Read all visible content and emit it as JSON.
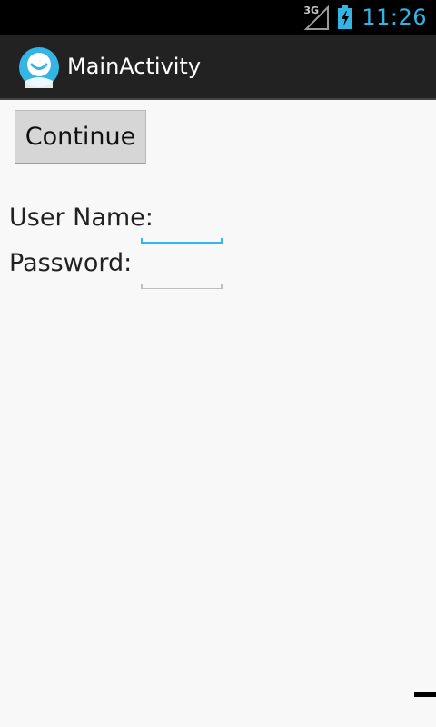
{
  "status_bar": {
    "network_type": "3G",
    "time": "11:26",
    "icons": [
      "signal-icon",
      "battery-charging-icon"
    ],
    "clock_color": "#33b5e5"
  },
  "action_bar": {
    "title": "MainActivity",
    "icon": "app-launcher-icon"
  },
  "form": {
    "continue_label": "Continue",
    "username_label": "User Name:",
    "username_value": "",
    "password_label": "Password:",
    "password_value": ""
  },
  "colors": {
    "accent": "#33b5e5",
    "action_bar_bg": "#222222",
    "content_bg": "#f8f8f8"
  }
}
